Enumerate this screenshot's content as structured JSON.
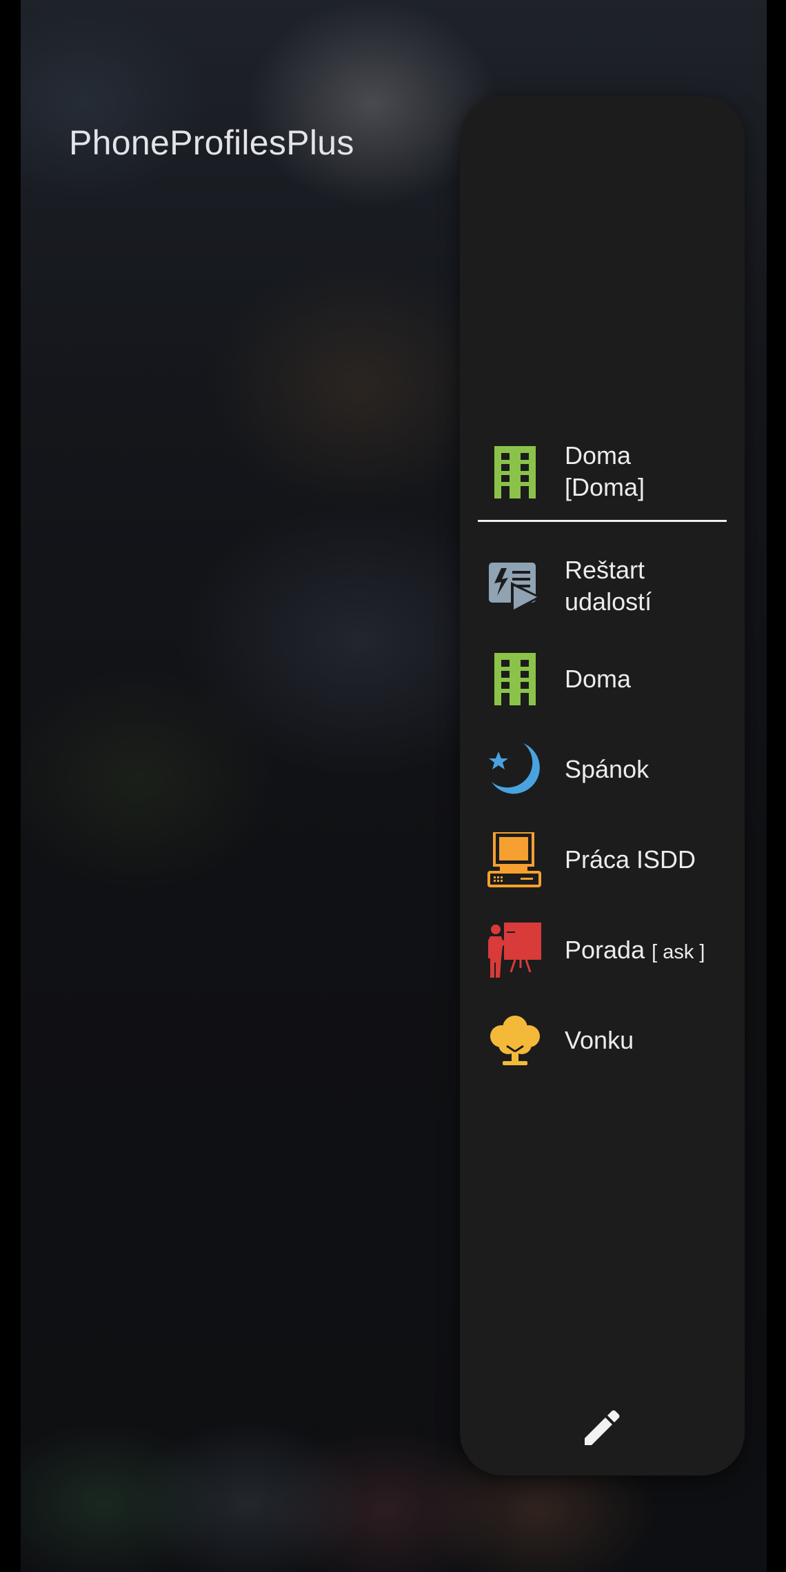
{
  "app": {
    "title": "PhoneProfilesPlus"
  },
  "active_profile": {
    "name": "Doma",
    "bracket": "[Doma]",
    "icon": "building-icon",
    "color": "#8bc34a"
  },
  "items": [
    {
      "label_line1": "Reštart",
      "label_line2": "udalostí",
      "icon": "restart-events-icon",
      "color": "#8fa3b3"
    },
    {
      "label": "Doma",
      "icon": "building-icon",
      "color": "#8bc34a"
    },
    {
      "label": "Spánok",
      "icon": "moon-icon",
      "color": "#4aa3df"
    },
    {
      "label": "Práca ISDD",
      "icon": "computer-icon",
      "color": "#f5a030"
    },
    {
      "label": "Porada",
      "suffix": "[ ask ]",
      "icon": "presentation-icon",
      "color": "#d93a3a"
    },
    {
      "label": "Vonku",
      "icon": "tree-icon",
      "color": "#f5b93a"
    }
  ],
  "footer": {
    "edit_icon": "pencil-icon"
  }
}
